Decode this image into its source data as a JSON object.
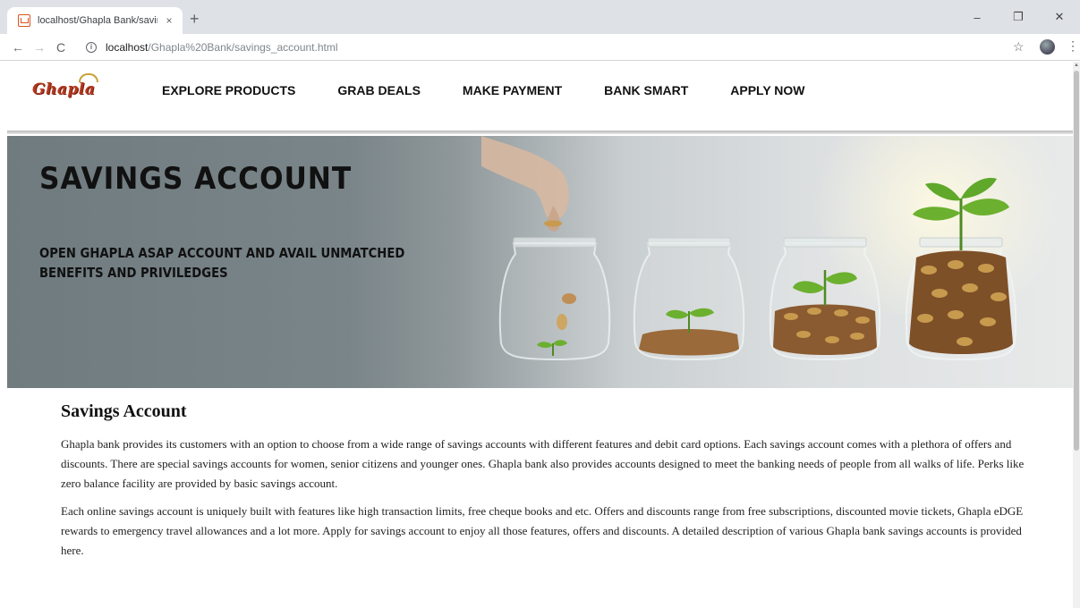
{
  "browser": {
    "tab_title": "localhost/Ghapla Bank/savings_a",
    "tab_close": "×",
    "new_tab": "+",
    "url_host": "localhost",
    "url_path": "/Ghapla%20Bank/savings_account.html",
    "window_controls": {
      "minimize": "–",
      "maximize": "❐",
      "close": "✕"
    },
    "nav": {
      "back": "←",
      "forward": "→",
      "reload": "C"
    },
    "star": "☆",
    "menu": "⋮"
  },
  "site": {
    "logo_text": "Ghapla",
    "nav": [
      {
        "label": "EXPLORE PRODUCTS"
      },
      {
        "label": "GRAB DEALS"
      },
      {
        "label": "MAKE PAYMENT"
      },
      {
        "label": "BANK SMART"
      },
      {
        "label": "APPLY NOW"
      }
    ]
  },
  "hero": {
    "title": "SAVINGS ACCOUNT",
    "subtitle": "OPEN GHAPLA ASAP ACCOUNT AND AVAIL UNMATCHED BENEFITS AND PRIVILEDGES"
  },
  "content": {
    "heading": "Savings Account",
    "paragraphs": [
      "Ghapla bank provides its customers with an option to choose from a wide range of savings accounts with different features and debit card options. Each savings account comes with a plethora of offers and discounts. There are special savings accounts for women, senior citizens and younger ones. Ghapla bank also provides accounts designed to meet the banking needs of people from all walks of life. Perks like zero balance facility are provided by basic savings account.",
      "Each online savings account is uniquely built with features like high transaction limits, free cheque books and etc. Offers and discounts range from free subscriptions, discounted movie tickets, Ghapla eDGE rewards to emergency travel allowances and a lot more. Apply for savings account to enjoy all those features, offers and discounts. A detailed description of various Ghapla bank savings accounts is provided here."
    ]
  },
  "colors": {
    "logo": "#b4381e",
    "hero_gray": "#7a8589",
    "leaf_green": "#5fa82a",
    "coin": "#b8803e"
  }
}
